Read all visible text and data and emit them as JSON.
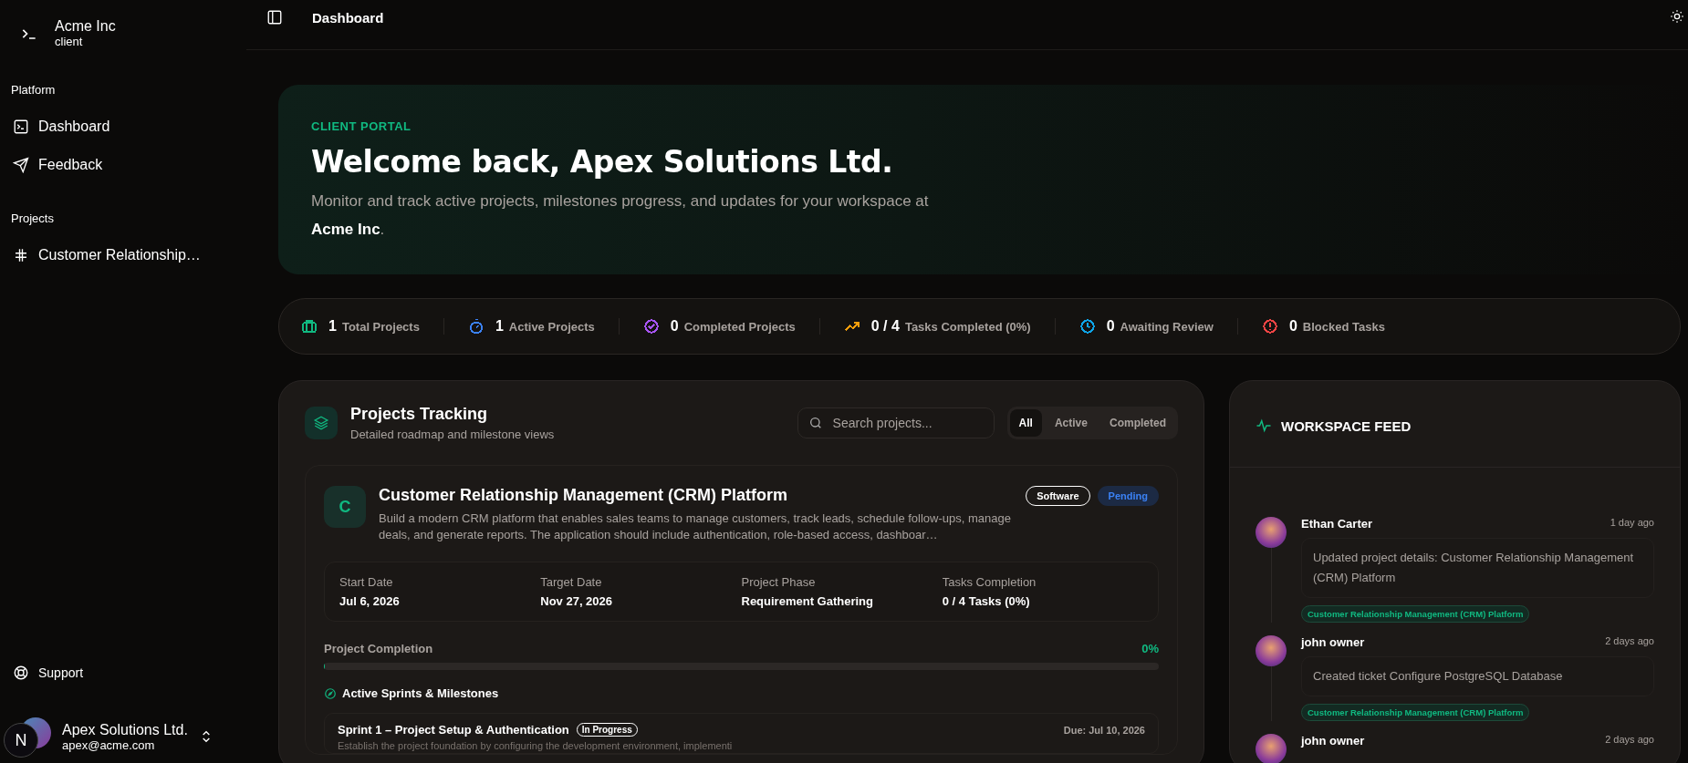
{
  "sidebar": {
    "org": {
      "name": "Acme Inc",
      "role": "client"
    },
    "groups": [
      {
        "label": "Platform",
        "items": [
          {
            "label": "Dashboard",
            "kind": "terminal",
            "selected": false
          },
          {
            "label": "Feedback",
            "kind": "send",
            "selected": false
          }
        ]
      },
      {
        "label": "Projects",
        "items": [
          {
            "label": "Customer Relationship…",
            "kind": "hash",
            "selected": false
          }
        ]
      }
    ],
    "support": "Support",
    "user": {
      "name": "Apex Solutions Ltd.",
      "email": "apex@acme.com",
      "badge": "N"
    }
  },
  "header": {
    "title": "Dashboard"
  },
  "hero": {
    "eyebrow": "CLIENT PORTAL",
    "title": "Welcome back, Apex Solutions Ltd.",
    "subtitle": "Monitor and track active projects, milestones progress, and updates for your workspace at **Acme Inc**."
  },
  "stats": [
    {
      "kind": "briefcase",
      "color": "#10b981",
      "value": "1",
      "label": "Total Projects"
    },
    {
      "kind": "timer",
      "color": "#3b82f6",
      "value": "1",
      "label": "Active Projects"
    },
    {
      "kind": "check",
      "color": "#a855f7",
      "value": "0",
      "label": "Completed Projects"
    },
    {
      "kind": "trend",
      "color": "#f59e0b",
      "value": "0 / 4",
      "label": "Tasks Completed (0%)"
    },
    {
      "kind": "clock",
      "color": "#0ea5e9",
      "value": "0",
      "label": "Awaiting Review"
    },
    {
      "kind": "alert",
      "color": "#ef4444",
      "value": "0",
      "label": "Blocked Tasks"
    }
  ],
  "projects": {
    "title": "Projects Tracking",
    "subtitle": "Detailed roadmap and milestone views",
    "search": {
      "placeholder": "Search projects..."
    },
    "filters": [
      {
        "label": "All",
        "selected": true
      },
      {
        "label": "Active",
        "selected": false
      },
      {
        "label": "Completed",
        "selected": false
      }
    ],
    "items": [
      {
        "initial": "C",
        "name": "Customer Relationship Management (CRM) Platform",
        "category": "Software",
        "status": "Pending",
        "description": "Build a modern CRM platform that enables sales teams to manage customers, track leads, schedule follow-ups, manage deals, and generate reports. The application should include authentication, role-based access, dashboar…",
        "facts": [
          {
            "label": "Start Date",
            "value": "Jul 6, 2026"
          },
          {
            "label": "Target Date",
            "value": "Nov 27, 2026"
          },
          {
            "label": "Project Phase",
            "value": "Requirement Gathering"
          },
          {
            "label": "Tasks Completion",
            "value": "0 / 4 Tasks (0%)"
          }
        ],
        "completion": {
          "label": "Project Completion",
          "reading": "0%",
          "level": 0
        },
        "sprints_title": "Active Sprints & Milestones",
        "sprints": [
          {
            "name": "Sprint 1 – Project Setup & Authentication",
            "status": "In Progress",
            "due": "Due: Jul 10, 2026",
            "description": "Establish the project foundation by configuring the development environment, implementi"
          }
        ]
      }
    ]
  },
  "feed": {
    "title": "WORKSPACE FEED",
    "items": [
      {
        "user": "Ethan Carter",
        "time": "1 day ago",
        "message": "Updated project details: Customer Relationship Management (CRM) Platform",
        "tag": "Customer Relationship Management (CRM) Platform"
      },
      {
        "user": "john owner",
        "time": "2 days ago",
        "message": "Created ticket Configure PostgreSQL Database",
        "tag": "Customer Relationship Management (CRM) Platform"
      },
      {
        "user": "john owner",
        "time": "2 days ago"
      }
    ]
  }
}
